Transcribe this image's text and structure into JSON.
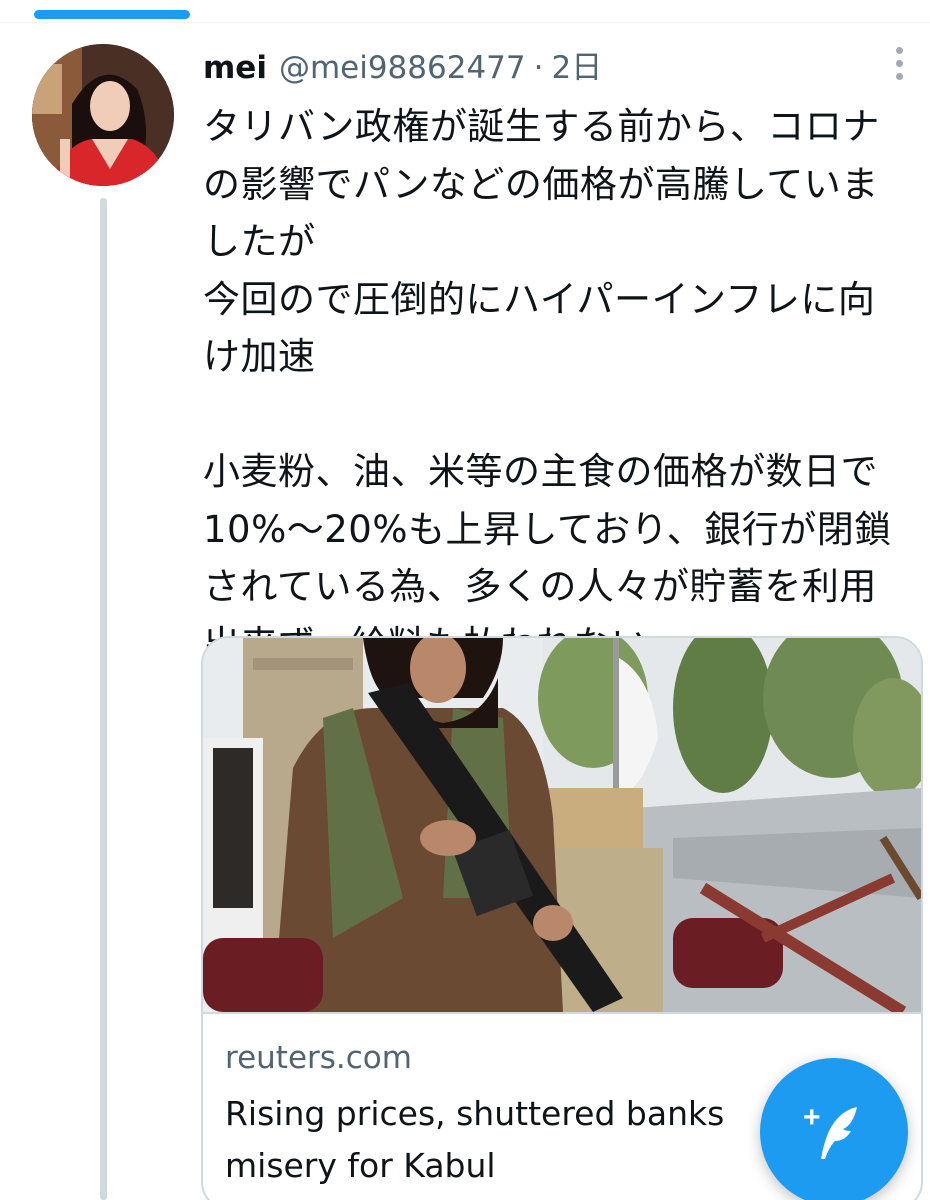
{
  "tweet": {
    "display_name": "mei",
    "handle": "@mei98862477",
    "separator": "·",
    "time": "2日",
    "paragraphs": [
      "タリバン政権が誕生する前から、コロナ\nの影響でパンなどの価格が高騰していま\nしたが\n今回ので圧倒的にハイパーインフレに向\nけ加速",
      "小麦粉、油、米等の主食の価格が数日で\n10%〜20%も上昇しており、銀行が閉鎖\nされている為、多くの人々が貯蓄を利用\n出来ず、給料も払われない"
    ],
    "more_icon": "more-horizontal-icon"
  },
  "card": {
    "domain": "reuters.com",
    "title_line1": "Rising prices, shuttered banks",
    "title_line2": "misery for Kabul"
  },
  "fab": {
    "icon": "compose-tweet-icon",
    "plus": "+"
  },
  "colors": {
    "accent": "#1d9bf0",
    "text_primary": "#0f1419",
    "text_secondary": "#536471",
    "border": "#cfd9de"
  }
}
